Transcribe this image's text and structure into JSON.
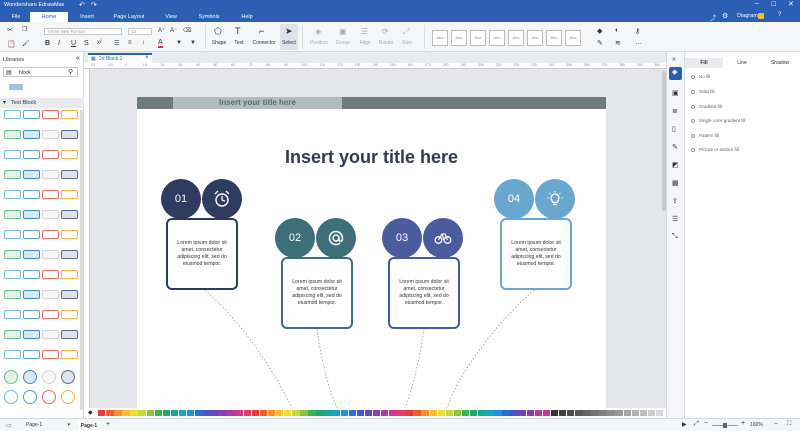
{
  "app": {
    "title": "Wondershare EdrawMax"
  },
  "menu": [
    "File",
    "Home",
    "Insert",
    "Page Layout",
    "View",
    "Symbols",
    "Help"
  ],
  "user": {
    "label": "Diagram"
  },
  "ribbon": {
    "font_name": "Times New Roman",
    "font_size": "12",
    "tools": [
      "Shape",
      "Text",
      "Connector",
      "Select"
    ],
    "disabled_tools": [
      "Position",
      "Group",
      "Align",
      "Rotate",
      "Size"
    ],
    "style_label": "Abc"
  },
  "libraries": {
    "header": "Libraries",
    "search_value": "block",
    "section": "Text Block"
  },
  "doc_tab": {
    "name": "2d Block 1"
  },
  "ruler": {
    "h": [
      "-20",
      "-10",
      "0",
      "10",
      "20",
      "30",
      "40",
      "50",
      "60",
      "70",
      "80",
      "90",
      "100",
      "110",
      "120",
      "130",
      "140",
      "150",
      "160",
      "170",
      "180",
      "190",
      "200",
      "210",
      "220",
      "230",
      "240",
      "250",
      "260",
      "270",
      "280",
      "290",
      "300"
    ]
  },
  "slide": {
    "header_bar": "Insert your title here",
    "main_title": "Insert your title here",
    "items": [
      {
        "num": "01",
        "icon": "alarm-clock-icon",
        "text": "Lorem ipsum dolor sit amet, consectetur adipiscing elit, sed do eiusmod tempor.",
        "color": "#2f3b5f"
      },
      {
        "num": "02",
        "icon": "at-sign-icon",
        "text": "Lorem ipsum dolor sit amet, consectetur adipiscing elit, sed do eiusmod tempor.",
        "color": "#3e6e7a"
      },
      {
        "num": "03",
        "icon": "bicycle-icon",
        "text": "Lorem ipsum dolor sit amet, consectetur adipiscing elit, sed do eiusmod tempor.",
        "color": "#4a5c9e"
      },
      {
        "num": "04",
        "icon": "lightbulb-icon",
        "text": "Lorem ipsum dolor sit amet, consectetur adipiscing elit, sed do eiusmod tempor.",
        "color": "#6aa7cf"
      }
    ]
  },
  "right_panel": {
    "tabs": [
      "Fill",
      "Line",
      "Shadow"
    ],
    "fill_options": [
      "No fill",
      "Solid fill",
      "Gradient fill",
      "Single color gradient fill",
      "Pattern fill",
      "Picture or texture fill"
    ]
  },
  "status": {
    "page_select": "Page-1",
    "page_tab": "Page-1",
    "zoom": "100%"
  },
  "palette": [
    "#e83a3a",
    "#f25a2f",
    "#f7912a",
    "#fbbf2c",
    "#f2dd2f",
    "#c7d93b",
    "#8cc63f",
    "#3fb34f",
    "#1fa872",
    "#18a89b",
    "#1ba3c7",
    "#2491d9",
    "#2f6fd1",
    "#4a56c3",
    "#6a47b8",
    "#8d3fb2",
    "#b23aa8",
    "#d3388f",
    "#e8396d",
    "#9e9e9e"
  ]
}
